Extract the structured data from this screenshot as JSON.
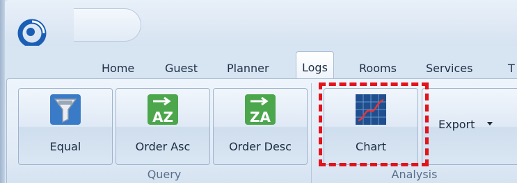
{
  "window": {
    "accent": "#1a5fb4"
  },
  "tabs": [
    {
      "label": "Home"
    },
    {
      "label": "Guest"
    },
    {
      "label": "Planner"
    },
    {
      "label": "Logs",
      "active": true
    },
    {
      "label": "Rooms"
    },
    {
      "label": "Services"
    },
    {
      "label": "T"
    }
  ],
  "groups": {
    "query": {
      "label": "Query",
      "buttons": [
        {
          "label": "Equal",
          "icon": "funnel-filter-icon"
        },
        {
          "label": "Order Asc",
          "icon": "sort-az-icon"
        },
        {
          "label": "Order Desc",
          "icon": "sort-za-icon"
        }
      ]
    },
    "analysis": {
      "label": "Analysis",
      "chart": {
        "label": "Chart",
        "icon": "line-chart-icon",
        "highlighted": true
      },
      "export": {
        "label": "Export",
        "icon": "dropdown-caret-icon"
      }
    }
  },
  "highlight_color": "#e3121b"
}
